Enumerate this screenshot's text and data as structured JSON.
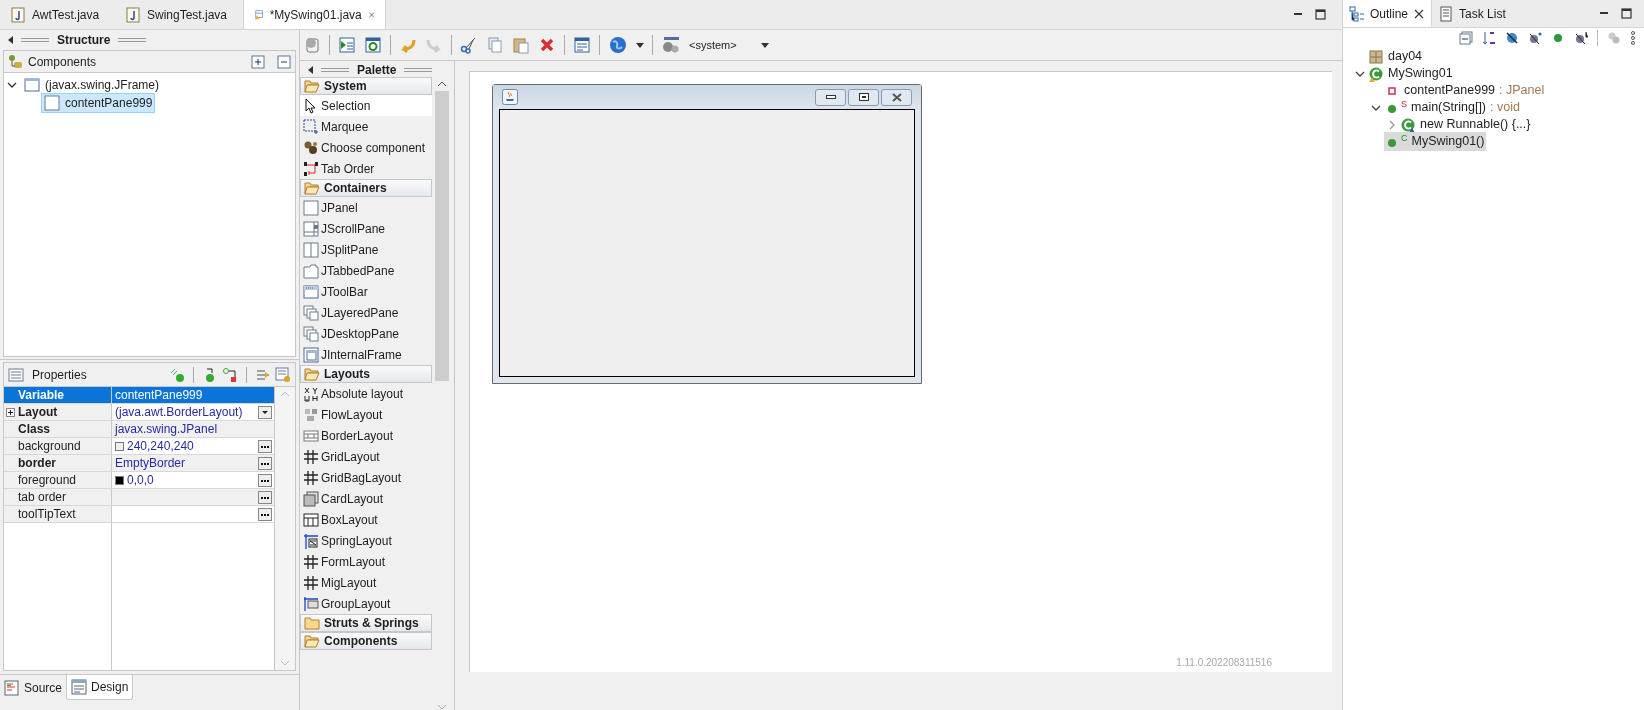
{
  "editor_tabs": [
    {
      "label": "AwtTest.java",
      "selected": false
    },
    {
      "label": "SwingTest.java",
      "selected": false
    },
    {
      "label": "*MySwing01.java",
      "selected": true
    }
  ],
  "structure": {
    "title": "Structure",
    "components_title": "Components",
    "tree": [
      {
        "label": "(javax.swing.JFrame)",
        "expanded": true,
        "selected": false,
        "children": [
          {
            "label": "contentPane999",
            "selected": true
          }
        ]
      }
    ]
  },
  "properties": {
    "title": "Properties",
    "rows": [
      {
        "name": "Variable",
        "value": "contentPane999",
        "bold": true,
        "selected": true
      },
      {
        "name": "Layout",
        "value": "(java.awt.BorderLayout)",
        "bold": true,
        "selected": false,
        "expandable": true,
        "dropdown": true
      },
      {
        "name": "Class",
        "value": "javax.swing.JPanel",
        "bold": true,
        "selected": false
      },
      {
        "name": "background",
        "value": "240,240,240",
        "bold": false,
        "selected": false,
        "color": "#f0f0f0",
        "ellipsis": true
      },
      {
        "name": "border",
        "value": "EmptyBorder",
        "bold": true,
        "selected": false,
        "ellipsis": true
      },
      {
        "name": "foreground",
        "value": "0,0,0",
        "bold": false,
        "selected": false,
        "color": "#000000",
        "ellipsis": true
      },
      {
        "name": "tab order",
        "bold": false,
        "selected": false,
        "ellipsis": true
      },
      {
        "name": "toolTipText",
        "bold": false,
        "selected": false,
        "ellipsis": true
      }
    ]
  },
  "toolbar": {
    "locale": "<system>"
  },
  "palette": {
    "title": "Palette",
    "groups": [
      {
        "label": "System",
        "expanded": true,
        "items": [
          {
            "label": "Selection",
            "kind": "pointer",
            "selected": true
          },
          {
            "label": "Marquee",
            "kind": "marquee",
            "selected": false
          },
          {
            "label": "Choose component",
            "kind": "chooser",
            "selected": false
          },
          {
            "label": "Tab Order",
            "kind": "taborder",
            "selected": false
          }
        ]
      },
      {
        "label": "Containers",
        "expanded": true,
        "items": [
          {
            "label": "JPanel",
            "kind": "panel",
            "selected": false
          },
          {
            "label": "JScrollPane",
            "kind": "scroll",
            "selected": false
          },
          {
            "label": "JSplitPane",
            "kind": "split",
            "selected": false
          },
          {
            "label": "JTabbedPane",
            "kind": "tabbed",
            "selected": false
          },
          {
            "label": "JToolBar",
            "kind": "toolbar",
            "selected": false
          },
          {
            "label": "JLayeredPane",
            "kind": "layered",
            "selected": false
          },
          {
            "label": "JDesktopPane",
            "kind": "layered",
            "selected": false
          },
          {
            "label": "JInternalFrame",
            "kind": "window",
            "selected": false
          }
        ]
      },
      {
        "label": "Layouts",
        "expanded": true,
        "items": [
          {
            "label": "Absolute layout",
            "kind": "absolute",
            "selected": false
          },
          {
            "label": "FlowLayout",
            "kind": "flow",
            "selected": false
          },
          {
            "label": "BorderLayout",
            "kind": "border",
            "selected": false
          },
          {
            "label": "GridLayout",
            "kind": "grid",
            "selected": false
          },
          {
            "label": "GridBagLayout",
            "kind": "grid",
            "selected": false
          },
          {
            "label": "CardLayout",
            "kind": "card",
            "selected": false
          },
          {
            "label": "BoxLayout",
            "kind": "box",
            "selected": false
          },
          {
            "label": "SpringLayout",
            "kind": "spring",
            "selected": false
          },
          {
            "label": "FormLayout",
            "kind": "grid",
            "selected": false
          },
          {
            "label": "MigLayout",
            "kind": "grid",
            "selected": false
          },
          {
            "label": "GroupLayout",
            "kind": "group",
            "selected": false
          }
        ]
      },
      {
        "label": "Struts & Springs",
        "expanded": false
      },
      {
        "label": "Components",
        "expanded": true
      }
    ]
  },
  "version": "1.11.0.202208311516",
  "bottom_tabs": [
    {
      "label": "Source",
      "selected": false
    },
    {
      "label": "Design",
      "selected": true
    }
  ],
  "outline": {
    "tabs": [
      {
        "label": "Outline",
        "selected": true
      },
      {
        "label": "Task List",
        "selected": false
      }
    ],
    "tree": [
      {
        "kind": "package",
        "name": "day04",
        "selected": false
      },
      {
        "kind": "class",
        "name": "MySwing01",
        "expanded": true,
        "selected": false,
        "children": [
          {
            "kind": "field",
            "name": "contentPane999",
            "type": " : JPanel",
            "selected": false
          },
          {
            "kind": "method",
            "badge": "S",
            "name": "main(String[])",
            "type": " : void",
            "expanded": true,
            "selected": false,
            "children": [
              {
                "kind": "anonymous",
                "name": "new Runnable() {...}",
                "expanded": false,
                "selected": false
              }
            ]
          },
          {
            "kind": "constructor",
            "badge": "C",
            "name": "MySwing01()",
            "selected": true
          }
        ]
      }
    ]
  }
}
